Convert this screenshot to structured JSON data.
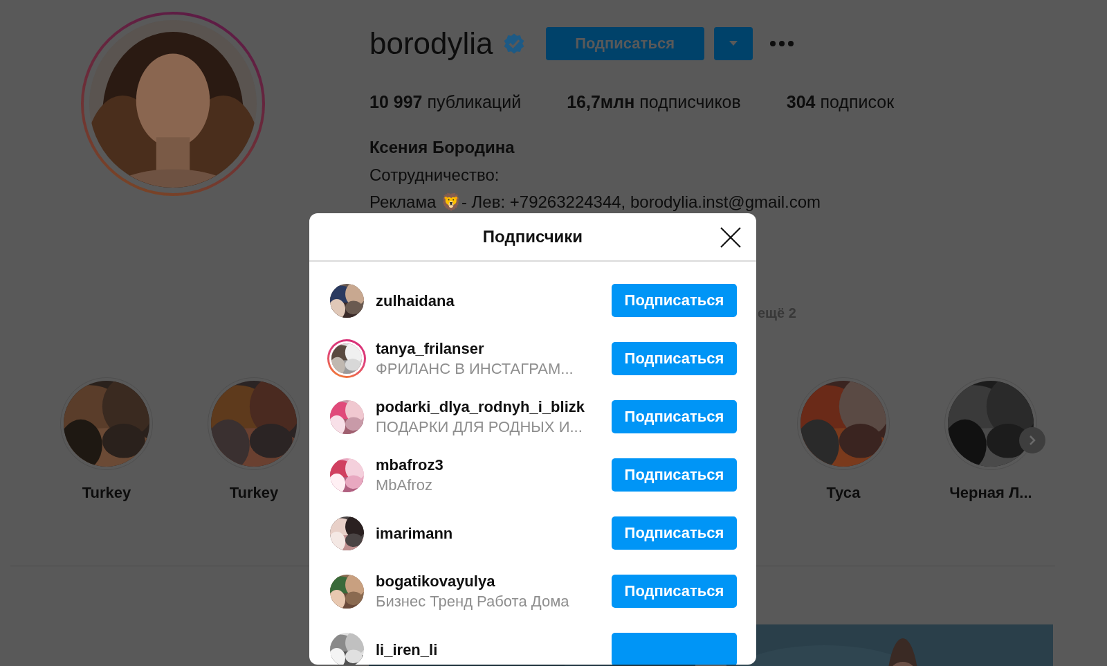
{
  "profile": {
    "username": "borodylia",
    "verified": true,
    "story": true,
    "follow_button": "Подписаться",
    "stats": [
      "**10 997** публикаций",
      "**16,7млн** подписчиков",
      "**304** подписок"
    ],
    "full_name": "Ксения Бородина",
    "bio": [
      "Сотрудничество:",
      "Реклама 🦁- Лев: +79263224344, borodylia.inst@gmail.com"
    ],
    "followed_by_more": "ещё 2"
  },
  "highlights": [
    {
      "title": "Turkey"
    },
    {
      "title": "Turkey"
    },
    {
      "title": "Туса"
    },
    {
      "title": "Черная Л..."
    }
  ],
  "modal": {
    "title": "Подписчики",
    "rows": [
      {
        "username": "zulhaidana",
        "story": false,
        "button": "Подписаться"
      },
      {
        "username": "tanya_frilanser",
        "subtitle": "ФРИЛАНС В ИНСТАГРАМ...",
        "story": true,
        "button": "Подписаться"
      },
      {
        "username": "podarki_dlya_rodnyh_i_blizk",
        "subtitle": "ПОДАРКИ ДЛЯ РОДНЫХ И...",
        "story": false,
        "button": "Подписаться"
      },
      {
        "username": "mbafroz3",
        "subtitle": "MbAfroz",
        "story": false,
        "button": "Подписаться"
      },
      {
        "username": "imarimann",
        "story": false,
        "button": "Подписаться"
      },
      {
        "username": "bogatikovayulya",
        "subtitle": "Бизнес Тренд Работа Дома",
        "story": false,
        "button": "Подписаться"
      },
      {
        "username": "li_iren_li",
        "story": false
      }
    ]
  }
}
